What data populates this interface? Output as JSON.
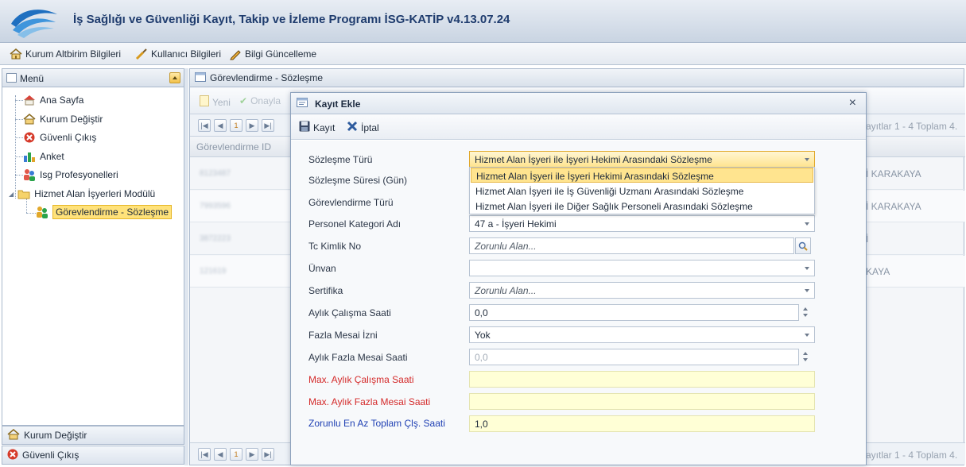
{
  "app": {
    "title": "İş Sağlığı ve Güvenliği Kayıt, Takip ve İzleme Programı İSG-KATİP v4.13.07.24"
  },
  "toolbar": {
    "items": [
      {
        "label": "Kurum Altbirim Bilgileri",
        "icon": "house-icon"
      },
      {
        "label": "Kullanıcı Bilgileri",
        "icon": "user-pen-icon"
      },
      {
        "label": "Bilgi Güncelleme",
        "icon": "pencil-icon"
      }
    ]
  },
  "menu": {
    "title": "Menü",
    "items": [
      {
        "label": "Ana Sayfa",
        "icon": "home-icon"
      },
      {
        "label": "Kurum Değiştir",
        "icon": "house-icon"
      },
      {
        "label": "Güvenli Çıkış",
        "icon": "exit-icon"
      },
      {
        "label": "Anket",
        "icon": "chart-icon"
      },
      {
        "label": "Isg Profesyonelleri",
        "icon": "people-icon"
      },
      {
        "label": "Hizmet Alan İşyerleri Modülü",
        "icon": "folder-icon"
      },
      {
        "label": "Görevlendirme - Sözleşme",
        "icon": "people-icon",
        "selected": true
      }
    ],
    "bottom": [
      {
        "label": "Kurum Değiştir",
        "icon": "house-icon"
      },
      {
        "label": "Güvenli Çıkış",
        "icon": "exit-icon"
      }
    ]
  },
  "main": {
    "panel_title": "Görevlendirme - Sözleşme",
    "grid_toolbar": {
      "new_label": "Yeni",
      "approve_label": "Onayla"
    },
    "pager": {
      "current_page": "1",
      "summary_top": "ayıtlar 1 - 4 Toplam 4.",
      "summary_bottom": "ayıtlar 1 - 4 Toplam 4."
    },
    "columns": [
      "Görevlendirme ID"
    ],
    "rows": [
      {
        "id": "8123487",
        "name": "İ KARAKAYA"
      },
      {
        "id": "7993596",
        "name": "İ KARAKAYA"
      },
      {
        "id": "3872223",
        "name": "İ"
      },
      {
        "id": "121619",
        "name": "KAYA"
      }
    ]
  },
  "dialog": {
    "title": "Kayıt Ekle",
    "close_symbol": "×",
    "save_label": "Kayıt",
    "cancel_label": "İptal",
    "fields": {
      "sozlesme_turu": {
        "label": "Sözleşme Türü",
        "value": "Hizmet Alan İşyeri ile İşyeri Hekimi Arasındaki Sözleşme"
      },
      "sozlesme_suresi": {
        "label": "Sözleşme Süresi (Gün)"
      },
      "gorevlendirme_turu": {
        "label": "Görevlendirme Türü"
      },
      "personel_kategori": {
        "label": "Personel Kategori Adı",
        "value": "47 a - İşyeri Hekimi"
      },
      "tc_kimlik": {
        "label": "Tc Kimlik No",
        "placeholder": "Zorunlu Alan..."
      },
      "unvan": {
        "label": "Ünvan",
        "value": ""
      },
      "sertifika": {
        "label": "Sertifika",
        "placeholder": "Zorunlu Alan..."
      },
      "aylik_calisma": {
        "label": "Aylık Çalışma Saati",
        "value": "0,0"
      },
      "fazla_mesai_izni": {
        "label": "Fazla Mesai İzni",
        "value": "Yok"
      },
      "aylik_fazla_mesai": {
        "label": "Aylık Fazla Mesai Saati",
        "value": "0,0"
      },
      "max_aylik_calisma": {
        "label": "Max. Aylık Çalışma Saati",
        "value": ""
      },
      "max_aylik_fazla": {
        "label": "Max. Aylık Fazla Mesai Saati",
        "value": ""
      },
      "zorunlu_en_az": {
        "label": "Zorunlu En Az Toplam Çlş. Saati",
        "value": "1,0"
      }
    },
    "dropdown_options": [
      "Hizmet Alan İşyeri ile İşyeri Hekimi Arasındaki Sözleşme",
      "Hizmet Alan İşyeri ile İş Güvenliği Uzmanı Arasındaki Sözleşme",
      "Hizmet Alan İşyeri ile Diğer Sağlık Personeli Arasındaki Sözleşme"
    ]
  },
  "colors": {
    "required_label": "#d42a2a",
    "info_label": "#1e3fb3",
    "highlight": "#ffe48f"
  }
}
